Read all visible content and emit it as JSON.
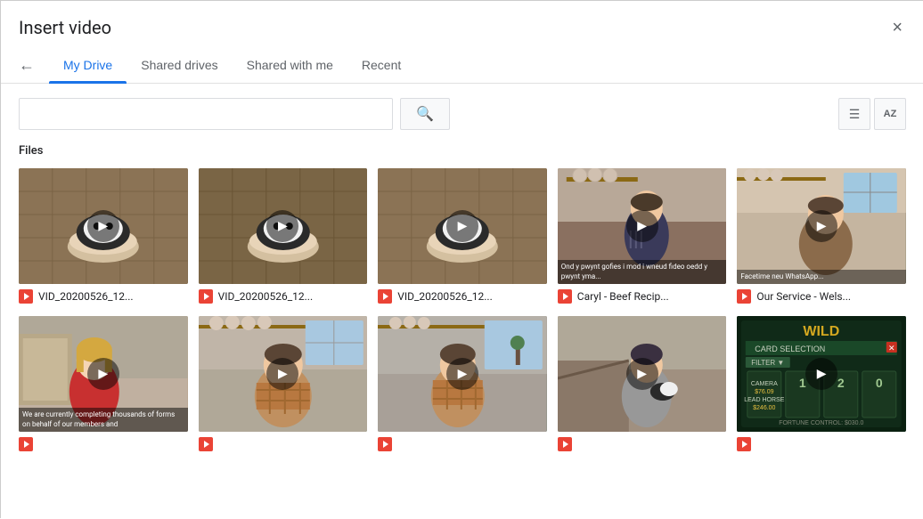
{
  "dialog": {
    "title": "Insert video",
    "close_label": "×"
  },
  "tabs": [
    {
      "id": "my-drive",
      "label": "My Drive",
      "active": true
    },
    {
      "id": "shared-drives",
      "label": "Shared drives",
      "active": false
    },
    {
      "id": "shared-with-me",
      "label": "Shared with me",
      "active": false
    },
    {
      "id": "recent",
      "label": "Recent",
      "active": false
    }
  ],
  "search": {
    "placeholder": "",
    "button_icon": "🔍"
  },
  "view_buttons": {
    "list_icon": "≡",
    "sort_icon": "AZ"
  },
  "files_label": "Files",
  "videos": [
    {
      "id": 1,
      "name": "VID_20200526_12...",
      "thumb_class": "thumb-1",
      "has_overlay": false
    },
    {
      "id": 2,
      "name": "VID_20200526_12...",
      "thumb_class": "thumb-2",
      "has_overlay": false
    },
    {
      "id": 3,
      "name": "VID_20200526_12...",
      "thumb_class": "thumb-3",
      "has_overlay": false
    },
    {
      "id": 4,
      "name": "Caryl - Beef Recip...",
      "thumb_class": "thumb-4",
      "has_overlay": true,
      "overlay_text": "Ond y pwynt gofies i mod i wneud fideo oedd y pwynt yma..."
    },
    {
      "id": 5,
      "name": "Our Service - Wels...",
      "thumb_class": "thumb-5",
      "has_overlay": true,
      "overlay_text": "Facetime neu WhatsApp..."
    },
    {
      "id": 6,
      "name": "",
      "thumb_class": "thumb-6",
      "has_overlay": true,
      "overlay_text": "We are currently completing thousands of forms on behalf of our members and"
    },
    {
      "id": 7,
      "name": "",
      "thumb_class": "thumb-7",
      "has_overlay": false
    },
    {
      "id": 8,
      "name": "",
      "thumb_class": "thumb-8",
      "has_overlay": false
    },
    {
      "id": 9,
      "name": "",
      "thumb_class": "thumb-9",
      "has_overlay": false
    },
    {
      "id": 10,
      "name": "",
      "thumb_class": "thumb-10",
      "has_overlay": false
    }
  ]
}
